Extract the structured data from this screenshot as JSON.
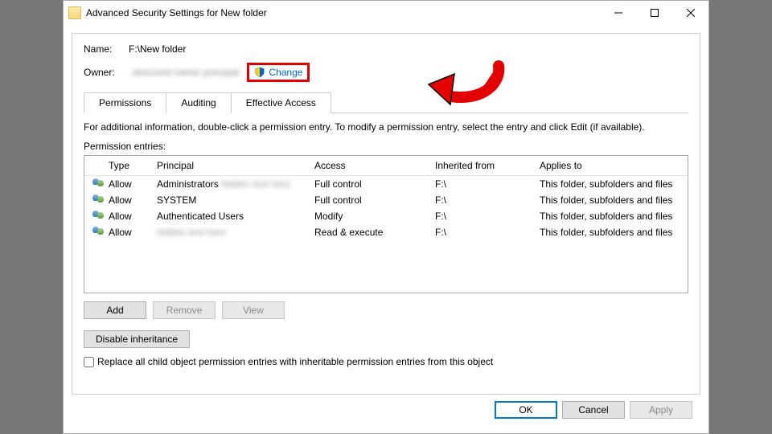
{
  "window": {
    "title": "Advanced Security Settings for New folder"
  },
  "fields": {
    "name_label": "Name:",
    "name_value": "F:\\New folder",
    "owner_label": "Owner:",
    "owner_value": "obscured owner principal",
    "change_label": "Change"
  },
  "tabs": {
    "permissions": "Permissions",
    "auditing": "Auditing",
    "effective": "Effective Access"
  },
  "info": "For additional information, double-click a permission entry. To modify a permission entry, select the entry and click Edit (if available).",
  "perm_entries_label": "Permission entries:",
  "table": {
    "headers": {
      "type": "Type",
      "principal": "Principal",
      "access": "Access",
      "inherited": "Inherited from",
      "applies": "Applies to"
    },
    "rows": [
      {
        "type": "Allow",
        "principal": "Administrators",
        "principal_extra_blurred": true,
        "access": "Full control",
        "inherited": "F:\\",
        "applies": "This folder, subfolders and files"
      },
      {
        "type": "Allow",
        "principal": "SYSTEM",
        "principal_extra_blurred": false,
        "access": "Full control",
        "inherited": "F:\\",
        "applies": "This folder, subfolders and files"
      },
      {
        "type": "Allow",
        "principal": "Authenticated Users",
        "principal_extra_blurred": false,
        "access": "Modify",
        "inherited": "F:\\",
        "applies": "This folder, subfolders and files"
      },
      {
        "type": "Allow",
        "principal": "",
        "principal_extra_blurred": true,
        "access": "Read & execute",
        "inherited": "F:\\",
        "applies": "This folder, subfolders and files"
      }
    ]
  },
  "buttons": {
    "add": "Add",
    "remove": "Remove",
    "view": "View",
    "disable_inherit": "Disable inheritance",
    "replace_checkbox": "Replace all child object permission entries with inheritable permission entries from this object",
    "ok": "OK",
    "cancel": "Cancel",
    "apply": "Apply"
  }
}
